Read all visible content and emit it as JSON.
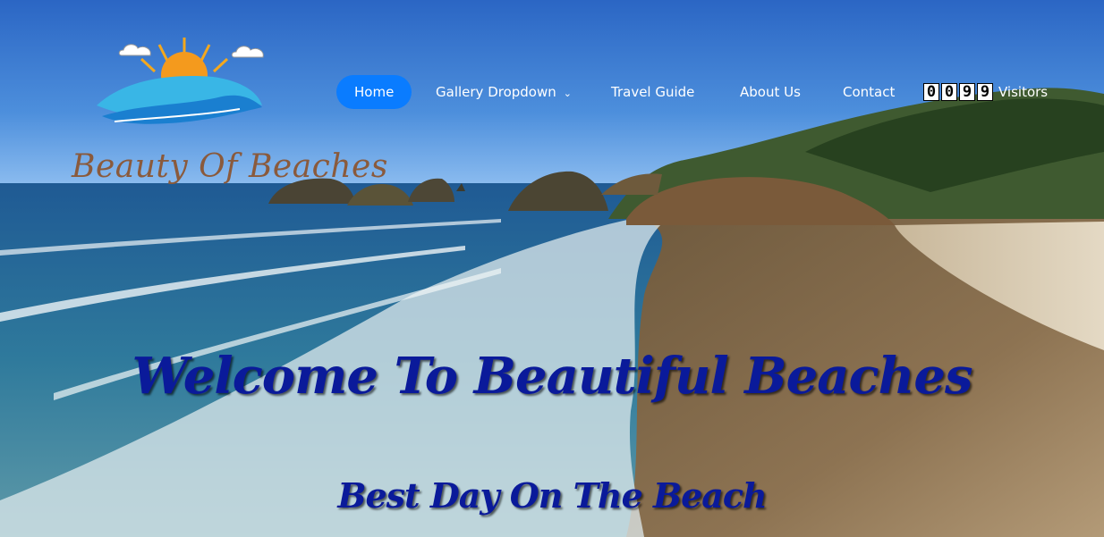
{
  "logo": {
    "text": "Beauty Of Beaches"
  },
  "nav": {
    "items": [
      {
        "label": "Home",
        "active": true
      },
      {
        "label": "Gallery Dropdown",
        "has_dropdown": true
      },
      {
        "label": "Travel Guide"
      },
      {
        "label": "About Us"
      },
      {
        "label": "Contact"
      }
    ],
    "counter": {
      "digits": [
        "0",
        "0",
        "9",
        "9"
      ],
      "label": "Visitors"
    }
  },
  "hero": {
    "headline": "Welcome To Beautiful Beaches",
    "subheadline": "Best Day On The Beach"
  },
  "colors": {
    "accent": "#0a7cff",
    "headline": "#0a1a9a",
    "logo_text": "#8a5a3c"
  }
}
